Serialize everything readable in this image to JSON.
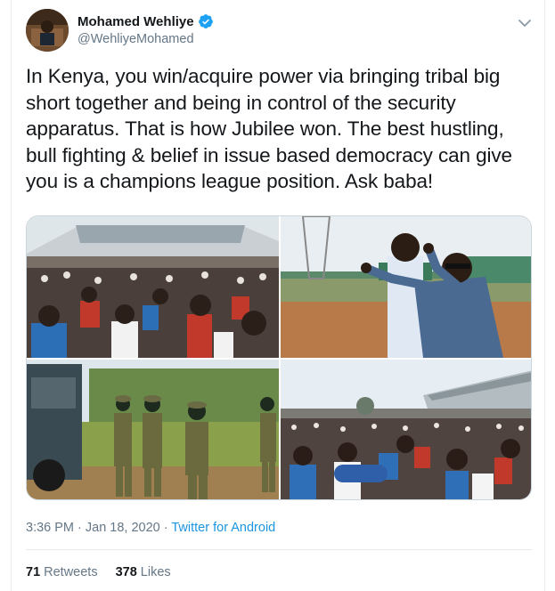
{
  "author": {
    "display_name": "Mohamed Wehliye",
    "handle": "@WehliyeMohamed",
    "verified": true
  },
  "tweet": {
    "text": "In Kenya, you win/acquire power via bringing tribal big short together and being in control of the security apparatus. That is how Jubilee won. The best hustling, bull fighting & belief in issue based democracy can give you is a champions league position. Ask baba!",
    "time": "3:36 PM",
    "separator": " · ",
    "date": "Jan 18, 2020",
    "source": "Twitter for Android"
  },
  "stats": {
    "retweets_count": "71",
    "retweets_label": "Retweets",
    "likes_count": "378",
    "likes_label": "Likes"
  },
  "media": [
    {
      "name": "crowd-stadium-photo"
    },
    {
      "name": "speaker-gesturing-photo"
    },
    {
      "name": "security-officers-photo"
    },
    {
      "name": "crowd-grandstand-photo"
    }
  ],
  "colors": {
    "link": "#1b95e0",
    "verified": "#1da1f2",
    "secondary_text": "#657786"
  },
  "icons": {
    "verified": "verified-badge-icon",
    "chevron": "chevron-down-icon"
  }
}
